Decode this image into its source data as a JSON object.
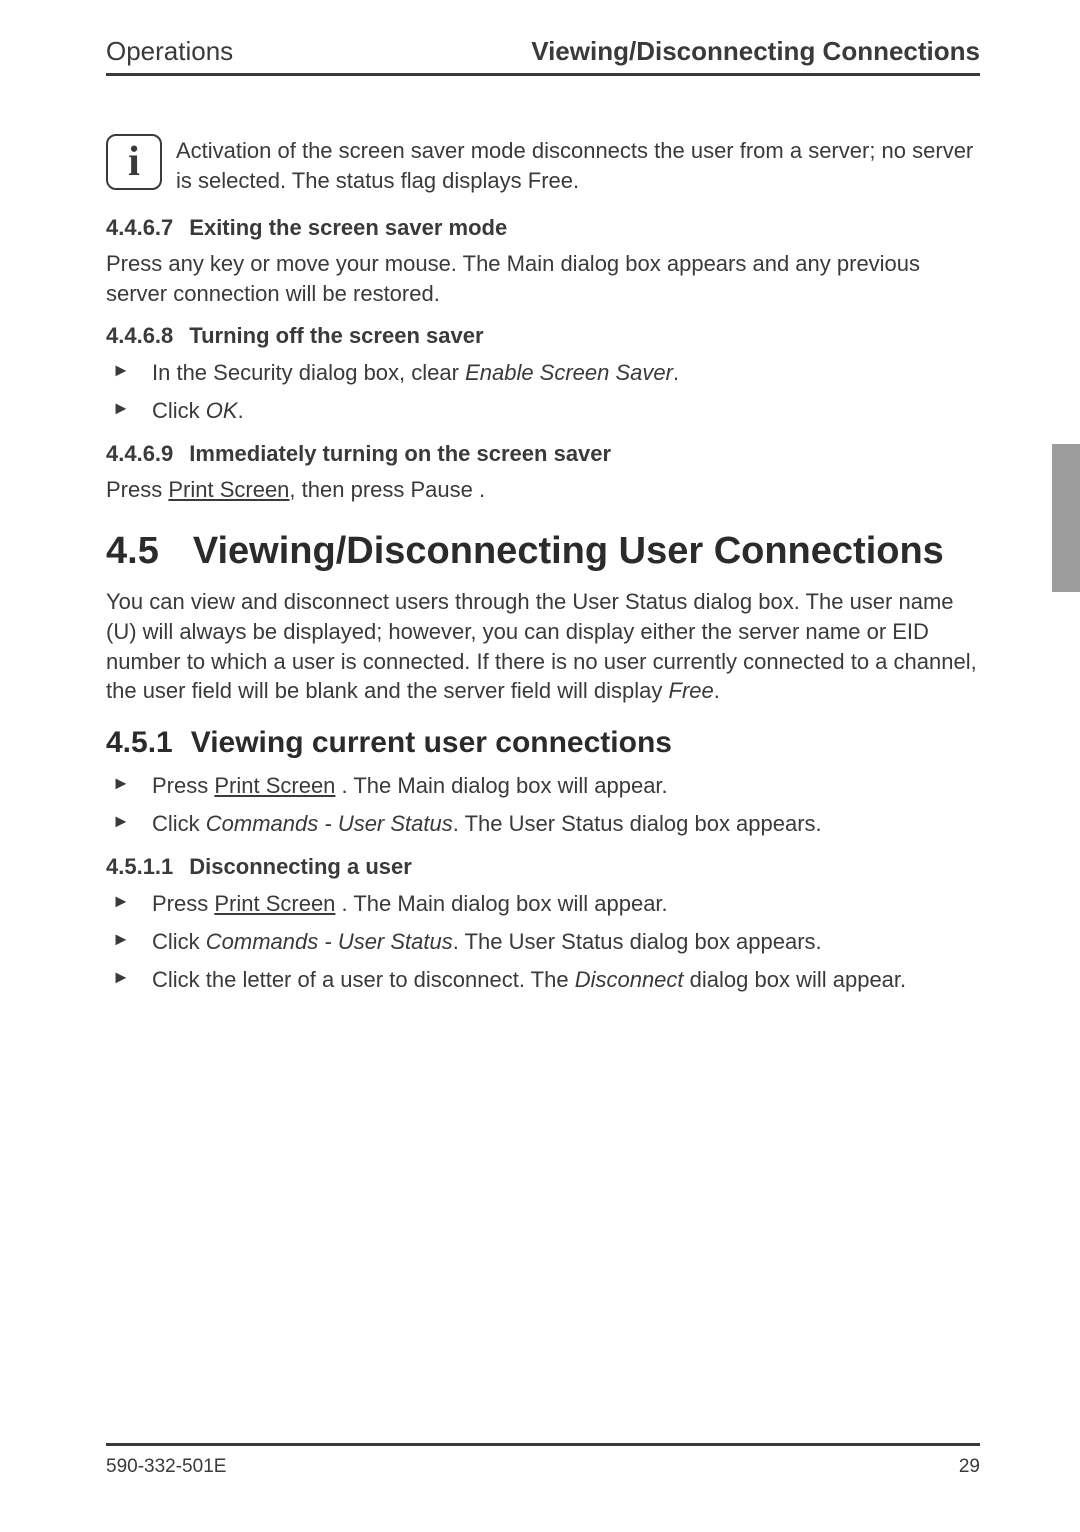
{
  "header": {
    "left": "Operations",
    "right": "Viewing/Disconnecting Connections"
  },
  "info_note": "Activation of the screen saver mode disconnects the user from a server; no server is selected. The status flag displays Free.",
  "sections": {
    "s4467": {
      "num": "4.4.6.7",
      "title": "Exiting the screen saver mode",
      "body": "Press any key or move your mouse. The Main dialog box appears and any previous server connection will be restored."
    },
    "s4468": {
      "num": "4.4.6.8",
      "title": "Turning off the screen saver",
      "steps": [
        {
          "pre": "In the Security dialog box, clear ",
          "em": "Enable Screen Saver",
          "post": "."
        },
        {
          "pre": "Click ",
          "em": "OK",
          "post": "."
        }
      ]
    },
    "s4469": {
      "num": "4.4.6.9",
      "title": "Immediately turning on the screen saver",
      "body_pre": "Press ",
      "body_u": "Print Screen",
      "body_post": ", then press Pause ."
    },
    "s45": {
      "num": "4.5",
      "title": "Viewing/Disconnecting User Connections",
      "body_pre": "You can view and disconnect users through the User Status dialog box. The user name (U) will always be displayed; however, you can display either the server name or EID number to which a user is connected. If there is no user currently connected to a channel, the user field will be blank and the server field will display ",
      "body_em": "Free",
      "body_post": "."
    },
    "s451": {
      "num": "4.5.1",
      "title": "Viewing current user connections",
      "steps": [
        {
          "pre": "Press ",
          "u": "Print Screen",
          "post": " . The Main dialog box will appear."
        },
        {
          "pre": "Click ",
          "em": "Commands - User Status",
          "post": ". The User Status dialog box appears."
        }
      ]
    },
    "s4511": {
      "num": "4.5.1.1",
      "title": "Disconnecting a user",
      "steps": [
        {
          "pre": "Press ",
          "u": "Print Screen",
          "post": " . The Main dialog box will appear."
        },
        {
          "pre": "Click ",
          "em": "Commands - User Status",
          "post": ". The User Status dialog box appears."
        },
        {
          "pre": "Click the letter of a user to disconnect.  The ",
          "em": "Disconnect",
          "post": " dialog box will appear."
        }
      ]
    }
  },
  "footer": {
    "doc_id": "590-332-501E",
    "page_num": "29"
  }
}
